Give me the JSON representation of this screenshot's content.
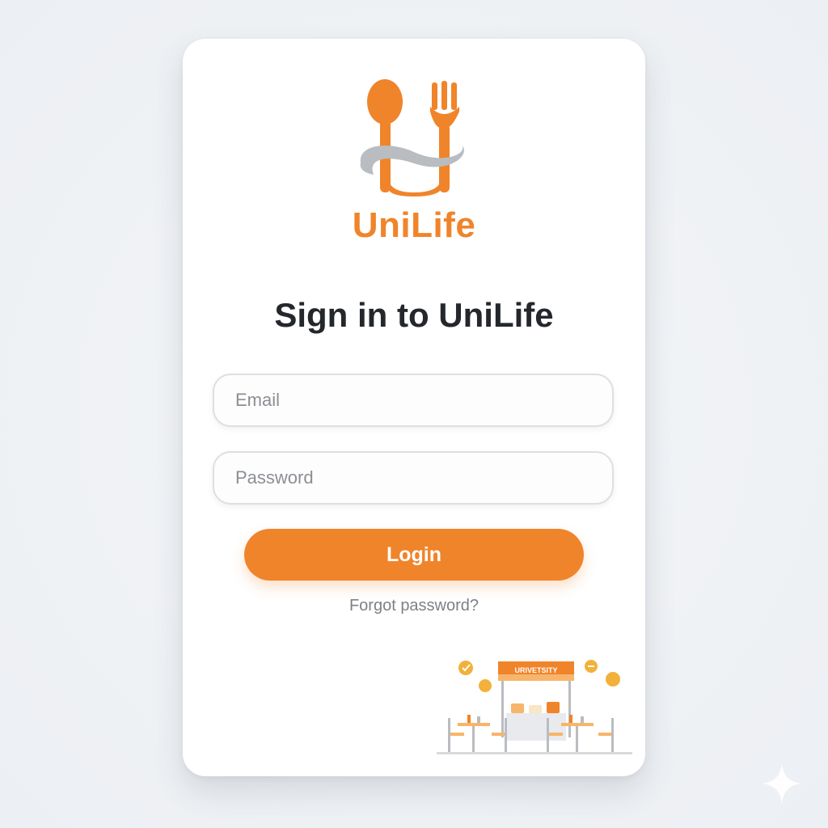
{
  "brand": {
    "name": "UniLife",
    "logo_icon": "spoon-fork-logo-icon",
    "accent_color": "#f0842a"
  },
  "login": {
    "heading": "Sign in to UniLife",
    "email_placeholder": "Email",
    "email_value": "",
    "password_placeholder": "Password",
    "password_value": "",
    "submit_label": "Login",
    "forgot_label": "Forgot password?"
  },
  "illustration": {
    "icon": "university-cafeteria-icon",
    "sign_text": "URIVETSITY"
  },
  "sparkle_icon": "sparkle-icon"
}
